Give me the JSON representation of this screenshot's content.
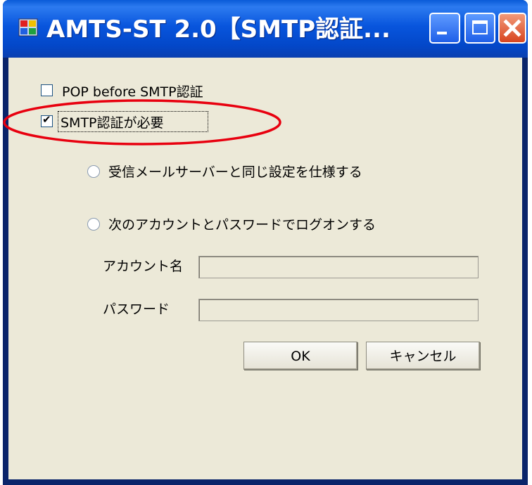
{
  "window": {
    "title": "AMTS-ST 2.0【SMTP認証...",
    "controls": {
      "minimize": "minimize-icon",
      "maximize": "maximize-icon",
      "close": "close-icon"
    }
  },
  "options": {
    "pop_before_smtp": {
      "label": "POP before SMTP認証",
      "checked": false
    },
    "smtp_auth_required": {
      "label": "SMTP認証が必要",
      "checked": true
    },
    "same_as_incoming": {
      "label": "受信メールサーバーと同じ設定を仕様する",
      "selected": false
    },
    "logon_with_account": {
      "label": "次のアカウントとパスワードでログオンする",
      "selected": false
    }
  },
  "fields": {
    "account": {
      "label": "アカウント名",
      "value": ""
    },
    "password": {
      "label": "パスワード",
      "value": ""
    }
  },
  "buttons": {
    "ok": "OK",
    "cancel": "キャンセル"
  },
  "colors": {
    "titlebar": "#0855dd",
    "dialog_background": "#ece9d8",
    "annotation_ellipse": "#e8000f"
  }
}
